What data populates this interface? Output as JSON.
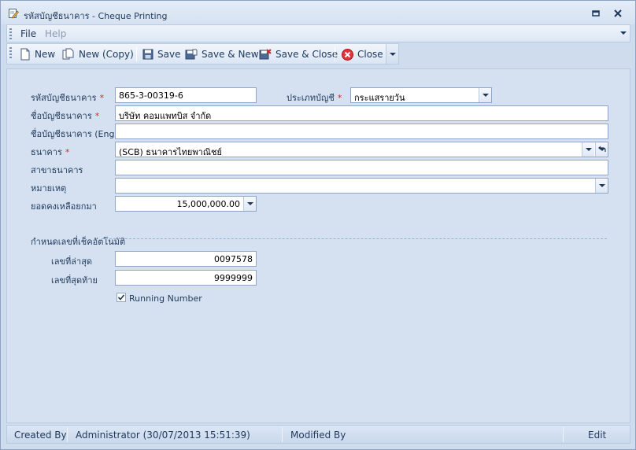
{
  "window": {
    "title": "รหัสบัญชีธนาคาร - Cheque Printing"
  },
  "menu": {
    "file": "File",
    "help": "Help"
  },
  "toolbar": {
    "new": "New",
    "new_copy": "New (Copy)",
    "save": "Save",
    "save_new": "Save & New",
    "save_close": "Save & Close",
    "close": "Close"
  },
  "form": {
    "account_code": {
      "label": "รหัสบัญชีธนาคาร",
      "value": "865-3-00319-6"
    },
    "account_type": {
      "label": "ประเภทบัญชี",
      "value": "กระแสรายวัน"
    },
    "account_name": {
      "label": "ชื่อบัญชีธนาคาร",
      "value": "บริษัท คอมแพทบิส จำกัด"
    },
    "account_name_eng": {
      "label": "ชื่อบัญชีธนาคาร (Eng)",
      "value": ""
    },
    "bank": {
      "label": "ธนาคาร",
      "value": "(SCB) ธนาคารไทยพาณิชย์"
    },
    "branch": {
      "label": "สาขาธนาคาร",
      "value": ""
    },
    "note": {
      "label": "หมายเหตุ",
      "value": ""
    },
    "balance": {
      "label": "ยอดคงเหลือยกมา",
      "value": "15,000,000.00"
    },
    "required_mark": "*"
  },
  "auto_cheque": {
    "group_label": "กำหนดเลขที่เช็คอัตโนมัติ",
    "latest": {
      "label": "เลขที่ล่าสุด",
      "value": "0097578"
    },
    "last": {
      "label": "เลขที่สุดท้าย",
      "value": "9999999"
    },
    "running_number": {
      "label": "Running Number",
      "checked": true
    }
  },
  "status": {
    "created_by_label": "Created By",
    "created_by_value": "Administrator (30/07/2013 15:51:39)",
    "modified_by_label": "Modified By",
    "edit": "Edit"
  },
  "colors": {
    "required": "#e02020",
    "close_icon": "#e0343a",
    "accent": "#1e395b"
  }
}
